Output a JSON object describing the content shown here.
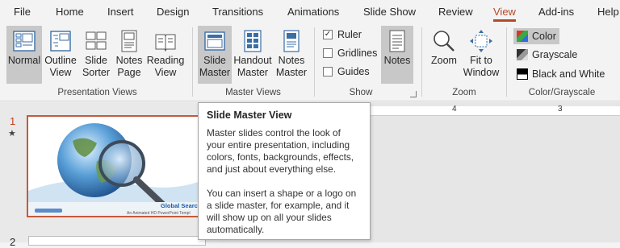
{
  "tabs": [
    "File",
    "Home",
    "Insert",
    "Design",
    "Transitions",
    "Animations",
    "Slide Show",
    "Review",
    "View",
    "Add-ins",
    "Help"
  ],
  "active_tab": "View",
  "ribbon": {
    "presentation_views": {
      "label": "Presentation Views",
      "buttons": [
        {
          "line1": "Normal",
          "line2": "",
          "icon": "normal-view-icon"
        },
        {
          "line1": "Outline",
          "line2": "View",
          "icon": "outline-view-icon"
        },
        {
          "line1": "Slide",
          "line2": "Sorter",
          "icon": "slide-sorter-icon"
        },
        {
          "line1": "Notes",
          "line2": "Page",
          "icon": "notes-page-icon"
        },
        {
          "line1": "Reading",
          "line2": "View",
          "icon": "reading-view-icon"
        }
      ]
    },
    "master_views": {
      "label": "Master Views",
      "buttons": [
        {
          "line1": "Slide",
          "line2": "Master",
          "icon": "slide-master-icon"
        },
        {
          "line1": "Handout",
          "line2": "Master",
          "icon": "handout-master-icon"
        },
        {
          "line1": "Notes",
          "line2": "Master",
          "icon": "notes-master-icon"
        }
      ]
    },
    "show": {
      "label": "Show",
      "checkboxes": [
        {
          "label": "Ruler",
          "checked": true
        },
        {
          "label": "Gridlines",
          "checked": false
        },
        {
          "label": "Guides",
          "checked": false
        }
      ],
      "notes_label": "Notes"
    },
    "zoom": {
      "label": "Zoom",
      "zoom_label": "Zoom",
      "fit_line1": "Fit to",
      "fit_line2": "Window"
    },
    "color_grayscale": {
      "label": "Color/Grayscale",
      "options": [
        "Color",
        "Grayscale",
        "Black and White"
      ],
      "selected": "Color"
    }
  },
  "slides": {
    "numbers": [
      "1",
      "2"
    ],
    "star": "★",
    "thumb_title": "Global Searc",
    "thumb_subtitle": "An Animated HD PowerPoint Templ"
  },
  "ruler": {
    "labels": [
      "4",
      "3"
    ]
  },
  "tooltip": {
    "title": "Slide Master View",
    "paragraph1": "Master slides control the look of your entire presentation, including colors, fonts, backgrounds, effects, and just about everything else.",
    "paragraph2": "You can insert a shape or a logo on a slide master, for example, and it will show up on all your slides automatically."
  },
  "colors": {
    "accent": "#b7472a",
    "selected_slide_border": "#c55a3b",
    "pressed_button": "#c8c8c8"
  }
}
